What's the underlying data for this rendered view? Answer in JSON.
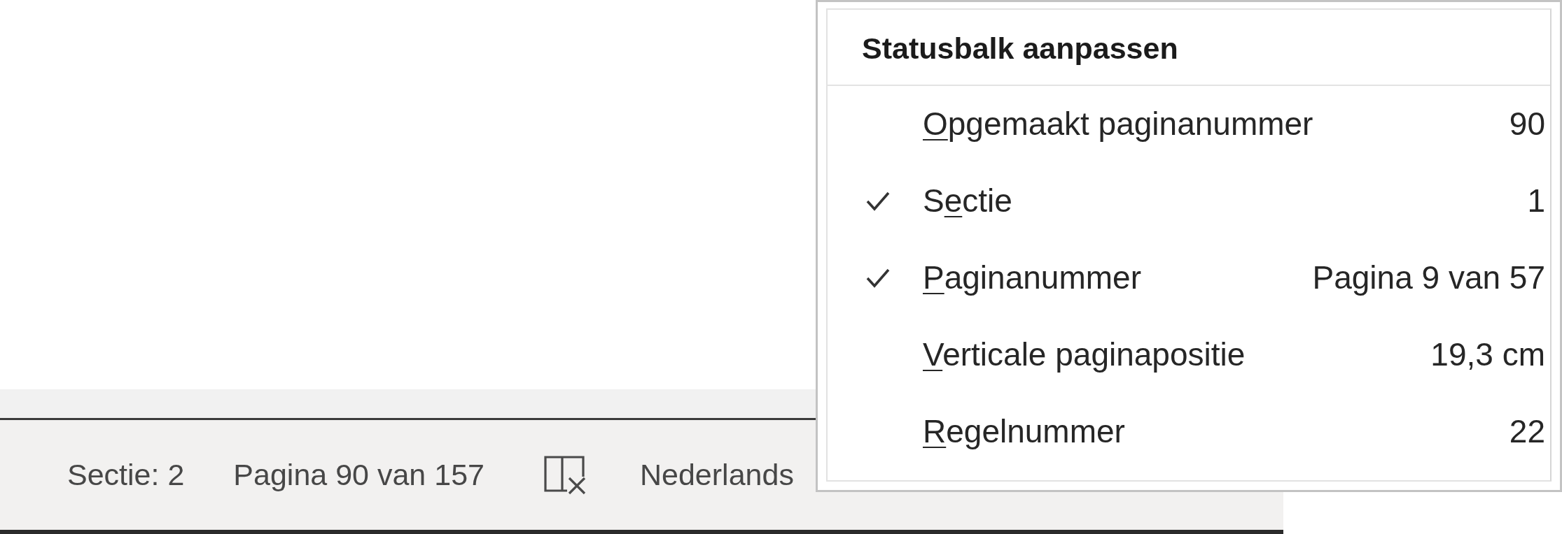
{
  "status_bar": {
    "items": [
      {
        "kind": "text",
        "text": "Sectie: 2"
      },
      {
        "kind": "text",
        "text": "Pagina 90 van 157"
      },
      {
        "kind": "icon"
      },
      {
        "kind": "text",
        "text": "Nederlands"
      }
    ]
  },
  "context_menu": {
    "title": "Statusbalk aanpassen",
    "items": [
      {
        "label": {
          "access_key": "O",
          "after": "pgemaakt paginanummer"
        },
        "value": "90",
        "checked": false
      },
      {
        "label": {
          "before": "S",
          "access_key": "e",
          "after": "ctie"
        },
        "value": "1",
        "checked": true
      },
      {
        "label": {
          "access_key": "P",
          "after": "aginanummer"
        },
        "value": "Pagina 9 van 57",
        "checked": true
      },
      {
        "label": {
          "access_key": "V",
          "after": "erticale paginapositie"
        },
        "value": "19,3 cm",
        "checked": false
      },
      {
        "label": {
          "access_key": "R",
          "after": "egelnummer"
        },
        "value": "22",
        "checked": false
      }
    ]
  }
}
